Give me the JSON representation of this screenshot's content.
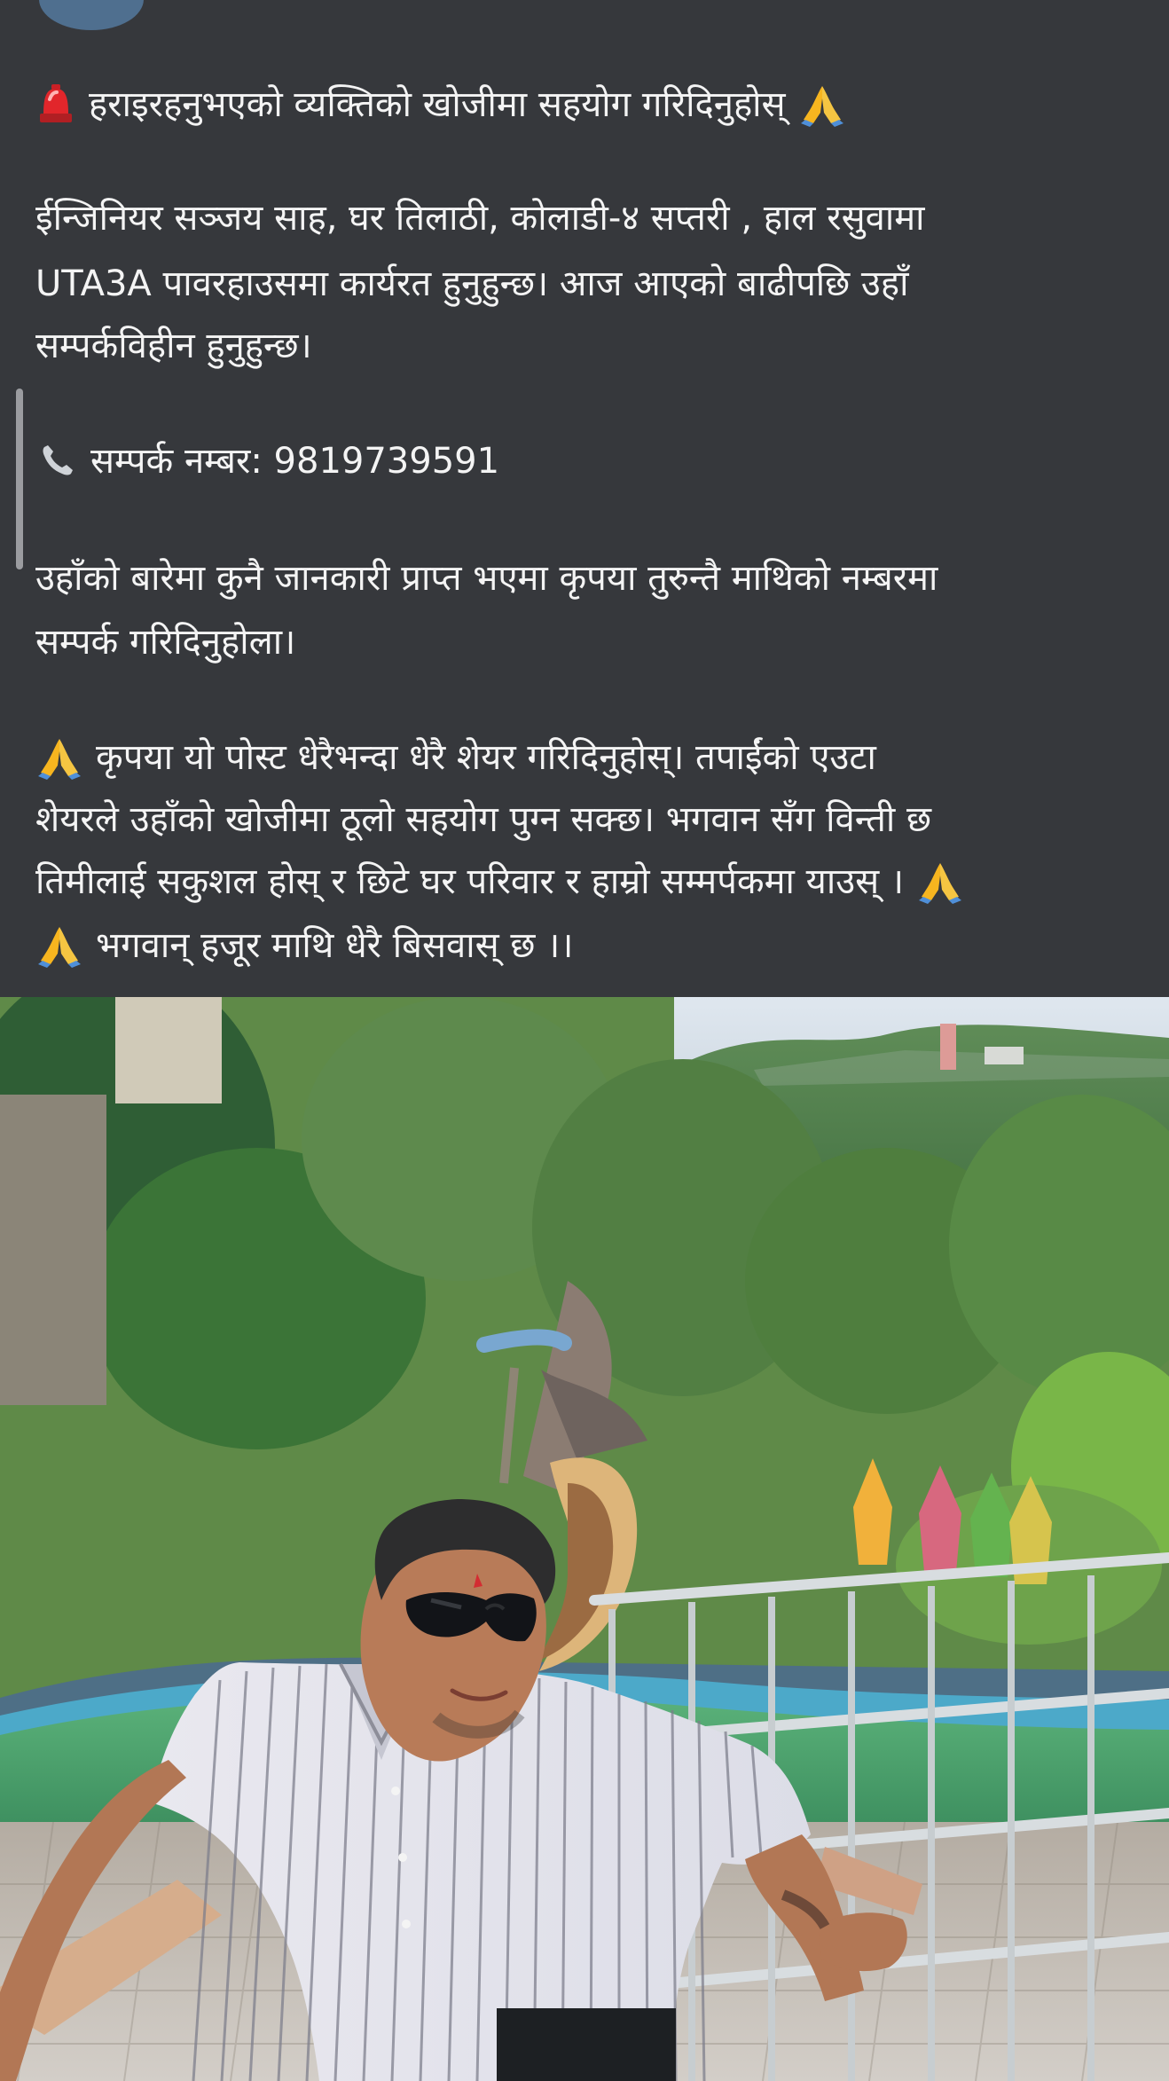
{
  "post": {
    "headline": "हराइरहनुभएको व्यक्तिको खोजीमा सहयोग गरिदिनुहोस्",
    "body_lines": [
      "ईन्जिनियर सञ्जय साह, घर तिलाठी, कोलाडी-४ सप्तरी , हाल रसुवामा",
      "UTA3A पावरहाउसमा कार्यरत हुनुहुन्छ। आज आएको बाढीपछि उहाँ",
      "सम्पर्कविहीन हुनुहुन्छ।"
    ],
    "contact_line": "सम्पर्क नम्बर: 9819739591",
    "request_lines": [
      "उहाँको बारेमा कुनै जानकारी प्राप्त भएमा कृपया तुरुन्तै माथिको नम्बरमा",
      "सम्पर्क गरिदिनुहोला।"
    ],
    "share_lines": [
      "कृपया यो पोस्ट धेरैभन्दा धेरै शेयर गरिदिनुहोस्। तपाईंको एउटा",
      "शेयरले उहाँको खोजीमा ठूलो सहयोग पुग्न सक्छ। भगवान सँग विन्ती छ",
      "तिमीलाई सकुशल होस् र छिटे घर परिवार र हाम्रो सम्मर्पकमा याउस् ।",
      "भगवान् हजूर माथि धेरै  बिसवास् छ ।।"
    ]
  },
  "icons": {
    "siren": "siren-icon",
    "pray": "pray-icon",
    "phone": "phone-icon"
  },
  "colors": {
    "background": "#36383c",
    "text": "#f4f4f4",
    "siren_red": "#e2262b",
    "pray_yellow": "#f7b51f",
    "sleeve_blue": "#5c9fe4"
  }
}
